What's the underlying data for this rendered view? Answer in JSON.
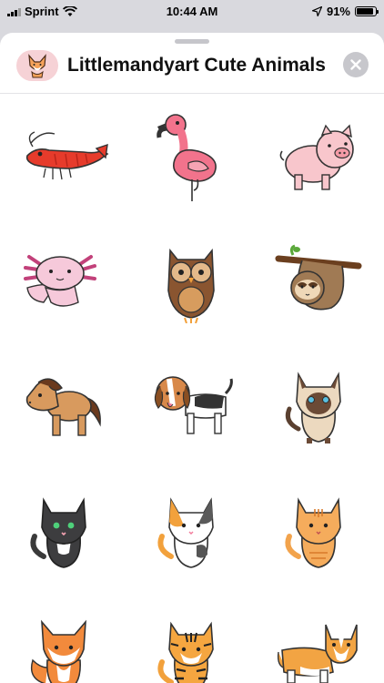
{
  "status_bar": {
    "carrier": "Sprint",
    "time": "10:44 AM",
    "battery": "91%",
    "battery_level": 0.91
  },
  "header": {
    "title": "Littlemandyart Cute Animals",
    "app_icon": "fox-icon",
    "close_icon": "close-icon"
  },
  "stickers": [
    {
      "name": "shrimp"
    },
    {
      "name": "flamingo"
    },
    {
      "name": "pig"
    },
    {
      "name": "axolotl"
    },
    {
      "name": "owl"
    },
    {
      "name": "sloth"
    },
    {
      "name": "horse"
    },
    {
      "name": "beagle"
    },
    {
      "name": "siamese-cat"
    },
    {
      "name": "black-cat"
    },
    {
      "name": "calico-cat"
    },
    {
      "name": "orange-cat"
    },
    {
      "name": "fox"
    },
    {
      "name": "tiger"
    },
    {
      "name": "corgi"
    }
  ],
  "colors": {
    "sheet_bg": "#ffffff",
    "backdrop": "#d9d9de",
    "close_button": "#c7c7cc",
    "app_icon_bg": "#f6d2d6"
  }
}
